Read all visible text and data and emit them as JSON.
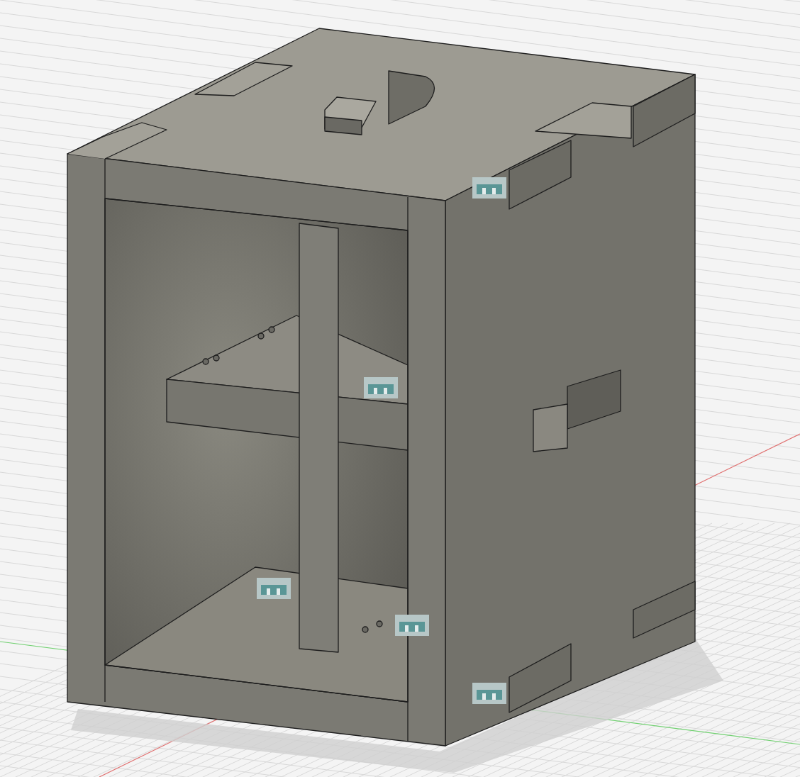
{
  "viewport": {
    "kind": "cad-model"
  }
}
